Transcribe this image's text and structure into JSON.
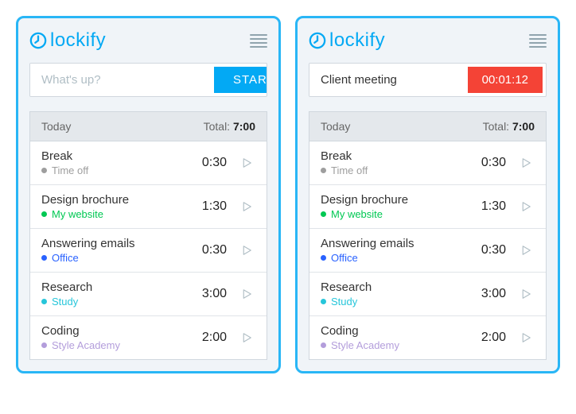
{
  "brand": "lockify",
  "left": {
    "placeholder": "What's up?",
    "start_label": "START"
  },
  "right": {
    "task_value": "Client meeting",
    "timer": "00:01:12"
  },
  "list": {
    "day_label": "Today",
    "total_label": "Total: ",
    "total_value": "7:00",
    "entries": [
      {
        "title": "Break",
        "project": "Time off",
        "color": "#9e9e9e",
        "time": "0:30"
      },
      {
        "title": "Design brochure",
        "project": "My website",
        "color": "#00c853",
        "time": "1:30"
      },
      {
        "title": "Answering emails",
        "project": "Office",
        "color": "#2962ff",
        "time": "0:30"
      },
      {
        "title": "Research",
        "project": "Study",
        "color": "#26c6da",
        "time": "3:00"
      },
      {
        "title": "Coding",
        "project": "Style Academy",
        "color": "#b39ddb",
        "time": "2:00"
      }
    ]
  }
}
